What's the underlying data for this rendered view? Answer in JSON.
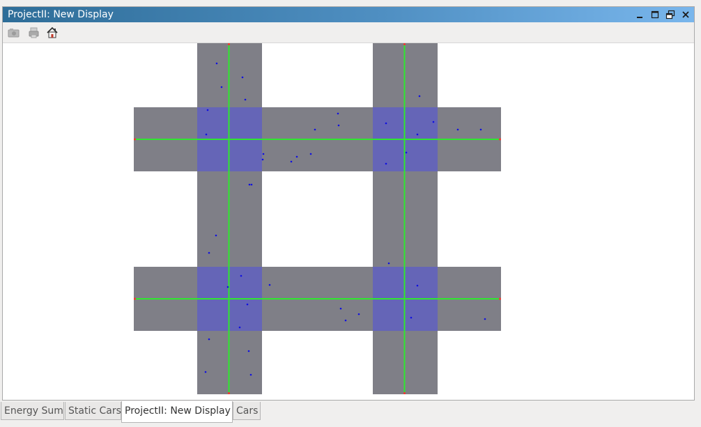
{
  "window": {
    "title": "ProjectII: New Display",
    "controls": [
      {
        "name": "minimize-button",
        "icon": "minimize-icon"
      },
      {
        "name": "maximize-button",
        "icon": "maximize-icon"
      },
      {
        "name": "restore-button",
        "icon": "restore-icon"
      },
      {
        "name": "close-button",
        "icon": "close-icon"
      }
    ]
  },
  "toolbar": {
    "buttons": [
      {
        "name": "camera-button",
        "icon": "camera-icon",
        "enabled": false
      },
      {
        "name": "print-button",
        "icon": "print-icon",
        "enabled": false
      },
      {
        "name": "home-button",
        "icon": "home-icon",
        "enabled": true
      }
    ]
  },
  "tabs": [
    {
      "label": "Energy Sum",
      "active": false
    },
    {
      "label": "Static Cars",
      "active": false
    },
    {
      "label": "ProjectII: New Display",
      "active": true
    },
    {
      "label": "Cars",
      "active": false
    }
  ],
  "colors": {
    "titlebar_start": "#2e6d98",
    "titlebar_end": "#79b6ec",
    "road": "#7f7f87",
    "intersection": "#6565b7",
    "lane_line": "#2ee82e",
    "car": "#1010e0",
    "endpoint": "#ff3030"
  }
}
